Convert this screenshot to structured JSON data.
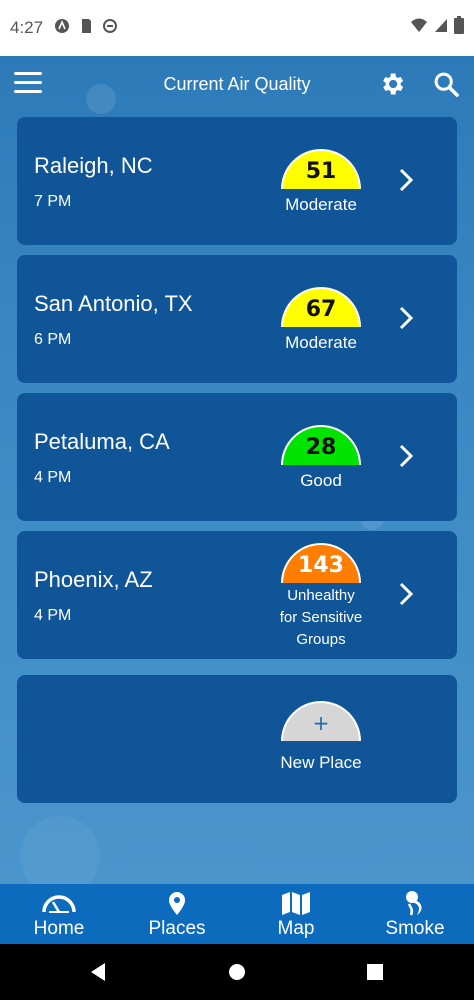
{
  "status_bar": {
    "time": "4:27"
  },
  "header": {
    "title": "Current Air Quality"
  },
  "places": [
    {
      "city": "Raleigh, NC",
      "time": "7 PM",
      "aqi": "51",
      "category": "Moderate",
      "color": "#ffff00"
    },
    {
      "city": "San Antonio, TX",
      "time": "6 PM",
      "aqi": "67",
      "category": "Moderate",
      "color": "#ffff00"
    },
    {
      "city": "Petaluma, CA",
      "time": "4 PM",
      "aqi": "28",
      "category": "Good",
      "color": "#00e400"
    },
    {
      "city": "Phoenix, AZ",
      "time": "4 PM",
      "aqi": "143",
      "category_lines": [
        "Unhealthy",
        "for Sensitive",
        "Groups"
      ],
      "color": "#ff7e00"
    }
  ],
  "new_place": {
    "symbol": "+",
    "label": "New Place"
  },
  "nav": {
    "home": "Home",
    "places": "Places",
    "map": "Map",
    "smoke": "Smoke"
  },
  "colors": {
    "card": "#0f5597",
    "nav": "#0d6bbd"
  }
}
